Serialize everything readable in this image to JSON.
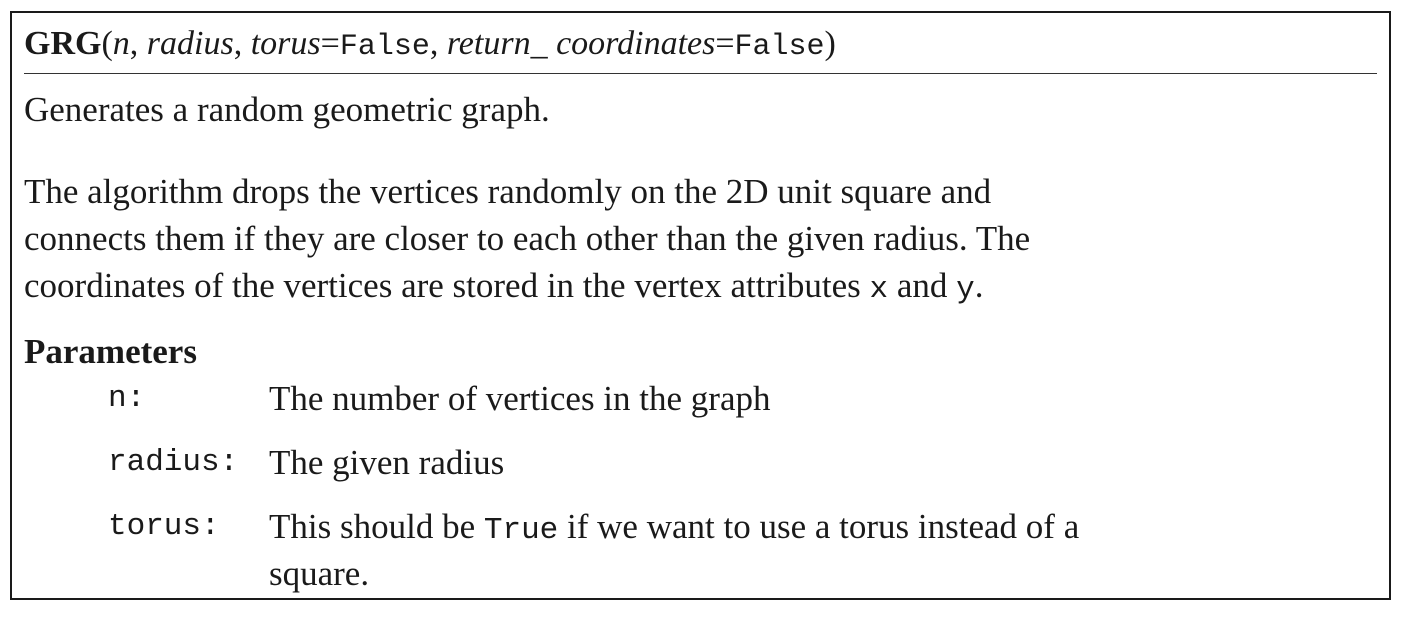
{
  "signature": {
    "function_name": "GRG",
    "open_paren": "(",
    "arg_n": "n",
    "sep1": ", ",
    "arg_radius": "radius",
    "sep2": ", ",
    "arg_torus": "torus",
    "eq1": "=",
    "torus_default": "False",
    "sep3": ", ",
    "arg_return_coordinates": "return_ coordinates",
    "eq2": "=",
    "return_coordinates_default": "False",
    "close_paren": ")"
  },
  "summary": "Generates a random geometric graph.",
  "description": {
    "line1": "The algorithm drops the vertices randomly on the 2D unit square and",
    "line2": "connects them if they are closer to each other than the given radius. The",
    "line3_prefix": "coordinates of the vertices are stored in the vertex attributes ",
    "attr_x": "x",
    "and": " and ",
    "attr_y": "y",
    "period": "."
  },
  "parameters": {
    "heading": "Parameters",
    "n": {
      "name": "n:",
      "desc": "The number of vertices in the graph"
    },
    "radius": {
      "name": "radius:",
      "desc": "The given radius"
    },
    "torus": {
      "name": "torus:",
      "desc_prefix": "This should be ",
      "desc_code": "True",
      "desc_suffix": " if we want to use a torus instead of a",
      "desc_line2": "square."
    }
  }
}
